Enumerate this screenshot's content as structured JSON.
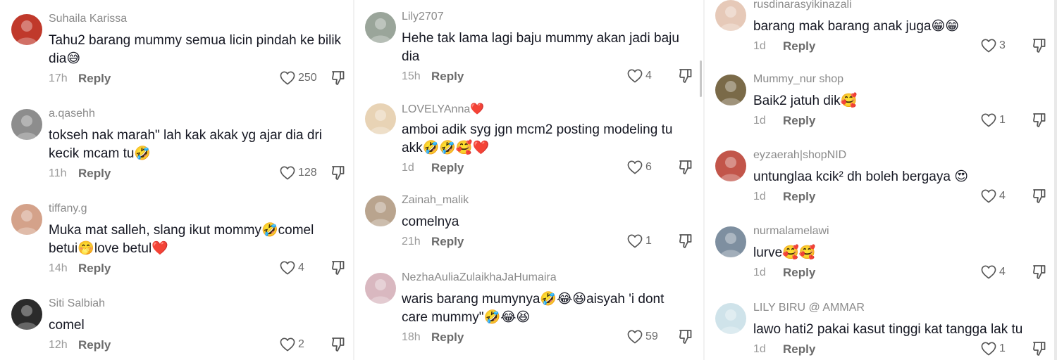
{
  "columns": [
    {
      "comments": [
        {
          "user": "Suhaila Karissa",
          "lines": [
            "Tahu2 barang mummy semua licin pindah ke bilik",
            "dia😅"
          ],
          "time": "17h",
          "reply": "Reply",
          "likes": "250",
          "avatar_color": "#c0392b"
        },
        {
          "user": "a.qasehh",
          "lines": [
            "tokseh nak marah\" lah kak akak yg ajar dia dri",
            "kecik mcam tu🤣"
          ],
          "time": "11h",
          "reply": "Reply",
          "likes": "128",
          "avatar_color": "#8d8d8d"
        },
        {
          "user": "tiffany.g",
          "lines": [
            "Muka mat salleh, slang ikut mommy🤣comel",
            "betui🤭love betul❤️"
          ],
          "time": "14h",
          "reply": "Reply",
          "likes": "4",
          "avatar_color": "#d4a28a"
        },
        {
          "user": "Siti Salbiah",
          "lines": [
            "comel"
          ],
          "time": "12h",
          "reply": "Reply",
          "likes": "2",
          "avatar_color": "#2b2b2b"
        }
      ]
    },
    {
      "comments": [
        {
          "user": "Lily2707",
          "lines": [
            "Hehe tak lama lagi baju mummy akan jadi baju",
            "dia"
          ],
          "time": "15h",
          "reply": "Reply",
          "likes": "4",
          "avatar_color": "#9aa59a"
        },
        {
          "user": "LOVELYAnna❤️",
          "lines": [
            "amboi adik syg jgn mcm2 posting modeling tu",
            "akk🤣🤣🥰❤️"
          ],
          "time": "1d",
          "reply": "Reply",
          "likes": "6",
          "avatar_color": "#e8d3b5"
        },
        {
          "user": "Zainah_malik",
          "lines": [
            "comelnya"
          ],
          "time": "21h",
          "reply": "Reply",
          "likes": "1",
          "avatar_color": "#b9a48e"
        },
        {
          "user": "NezhaAuliaZulaikhaJaHumaira",
          "lines": [
            "waris barang mumynya🤣😂😆aisyah 'i dont",
            "care mummy\"🤣😂😆"
          ],
          "time": "18h",
          "reply": "Reply",
          "likes": "59",
          "avatar_color": "#d9b8c0"
        }
      ]
    },
    {
      "comments": [
        {
          "user": "rusdinarasyikinazali",
          "lines": [
            "barang mak barang anak juga😁😁"
          ],
          "time": "1d",
          "reply": "Reply",
          "likes": "3",
          "avatar_color": "#e6c9b8"
        },
        {
          "user": "Mummy_nur shop",
          "lines": [
            "Baik2 jatuh dik🥰"
          ],
          "time": "1d",
          "reply": "Reply",
          "likes": "1",
          "avatar_color": "#7a6a48"
        },
        {
          "user": "eyzaerah|shopNID",
          "lines": [
            "untunglaa kcik² dh boleh bergaya 😍"
          ],
          "time": "1d",
          "reply": "Reply",
          "likes": "4",
          "avatar_color": "#c2554a"
        },
        {
          "user": "nurmalamelawi",
          "lines": [
            "lurve🥰🥰"
          ],
          "time": "1d",
          "reply": "Reply",
          "likes": "4",
          "avatar_color": "#7e8fa0"
        },
        {
          "user": "LILY BIRU @ AMMAR",
          "lines": [
            "lawo hati2 pakai kasut tinggi kat tangga lak tu"
          ],
          "time": "1d",
          "reply": "Reply",
          "likes": "1",
          "avatar_color": "#cfe3ea"
        }
      ]
    }
  ],
  "icons": {
    "like": "heart-outline-icon",
    "dislike": "thumbs-down-icon"
  }
}
